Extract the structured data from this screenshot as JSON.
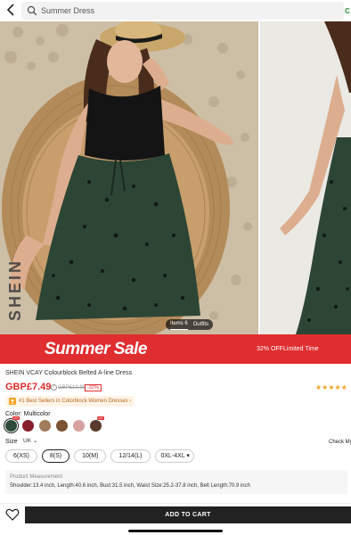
{
  "search": {
    "placeholder": "Summer Dress"
  },
  "gallery": {
    "watermark": "SHEIN",
    "items_label": "Items 6",
    "outfits_label": "Outfits"
  },
  "promo": {
    "title": "Summer Sale",
    "discount_text": "32% OFF",
    "limited_text": "Limited Time",
    "color": "#e02d2f"
  },
  "product": {
    "title": "SHEIN VCAY Colourblock Belted A-line Dress",
    "price": "GBP£7.49",
    "old_price": "GBP£10.99",
    "discount": "-32%",
    "rating_stars": 4.5,
    "bestseller": "#1 Best Sellers in Colorblock Women Dresses",
    "price_color": "#e02d2f"
  },
  "color": {
    "label": "Color: Multicolor",
    "swatches": [
      {
        "name": "multicolor-green",
        "color": "#2e4a38",
        "selected": true,
        "badge": "HOT"
      },
      {
        "name": "red",
        "color": "#8a1d2c",
        "selected": false,
        "badge": ""
      },
      {
        "name": "leopard",
        "color": "#a07c5a",
        "selected": false,
        "badge": ""
      },
      {
        "name": "brown-print",
        "color": "#7a5234",
        "selected": false,
        "badge": ""
      },
      {
        "name": "pink-print",
        "color": "#d9a0a0",
        "selected": false,
        "badge": ""
      },
      {
        "name": "floral",
        "color": "#5a3a2e",
        "selected": false,
        "badge": "HOT"
      }
    ]
  },
  "size": {
    "label": "Size",
    "region": "UK",
    "check_link": "Check My Size",
    "options": [
      {
        "label": "6(XS)",
        "selected": false
      },
      {
        "label": "8(S)",
        "selected": true
      },
      {
        "label": "10(M)",
        "selected": false
      },
      {
        "label": "12/14(L)",
        "selected": false
      },
      {
        "label": "0XL-4XL",
        "selected": false,
        "dropdown": true
      }
    ]
  },
  "measurement": {
    "title": "Product Measurement",
    "values": "Shoulder:13.4 inch, Length:40.6 inch, Bust:31.5 inch, Waist Size:25.2-37.8 inch, Belt Length:70.9 inch"
  },
  "actions": {
    "add_to_cart": "ADD TO CART"
  }
}
